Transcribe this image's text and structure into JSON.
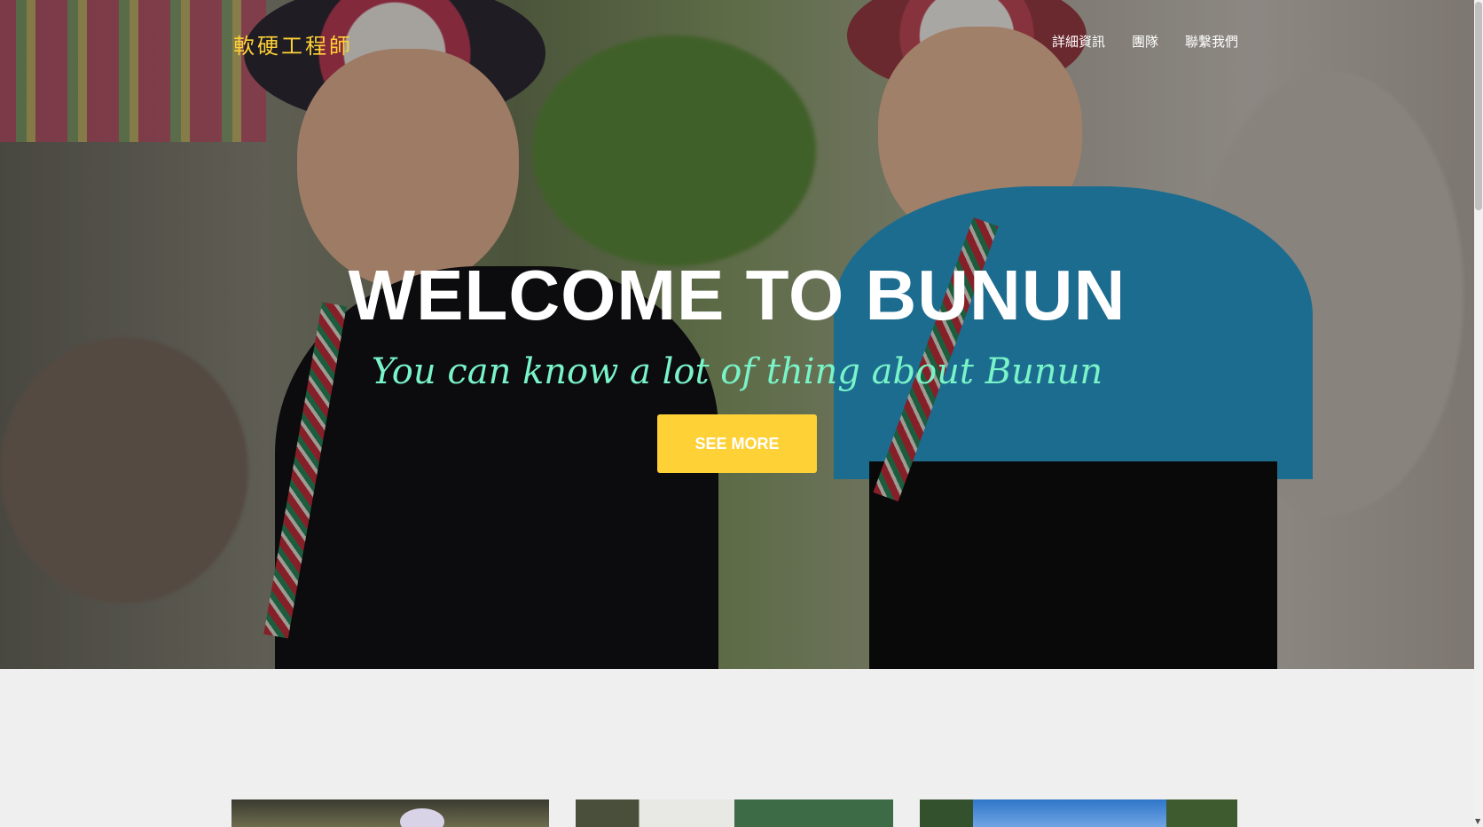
{
  "nav": {
    "logo": "軟硬工程師",
    "items": [
      {
        "label": "詳細資訊"
      },
      {
        "label": "團隊"
      },
      {
        "label": "聯繫我們"
      }
    ]
  },
  "hero": {
    "title": "WELCOME TO BUNUN",
    "subtitle": "You can know a lot of thing about Bunun",
    "button_label": "SEE MORE"
  },
  "colors": {
    "accent": "#fed136",
    "subtitle": "#79f3c8",
    "page_bg": "#efefef"
  }
}
